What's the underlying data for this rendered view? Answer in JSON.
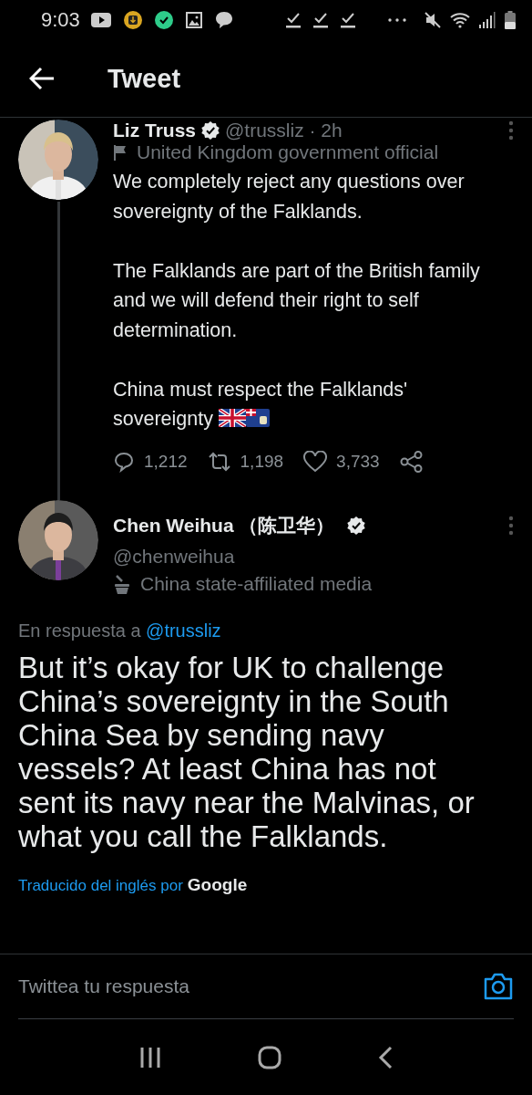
{
  "status_bar": {
    "time": "9:03"
  },
  "header": {
    "title": "Tweet"
  },
  "tweets": [
    {
      "kind": "parent",
      "thread_line": true,
      "name": "Liz Truss",
      "verified": true,
      "handle_line": "@trussliz · 2h",
      "label": {
        "kind": "flag",
        "text": "United Kingdom government official"
      },
      "text": "We completely reject any questions over sovereignty of the Falklands.\n\nThe Falklands are part of the British family and we will defend their right to self determination.\n\nChina must respect the Falklands' sovereignty",
      "stats": {
        "replies": "1,212",
        "retweets": "1,198",
        "likes": "3,733"
      }
    },
    {
      "kind": "focused",
      "thread_line": false,
      "name": "Chen Weihua （陈卫华）",
      "verified": true,
      "handle_line": "@chenweihua",
      "label": {
        "kind": "media",
        "text": "China state-affiliated media"
      },
      "reply_to": {
        "prefix": "En respuesta a",
        "mention": "@trussliz"
      },
      "text": "But it’s okay for UK to challenge China’s sovereignty in the South China Sea by sending navy vessels? At least China has not sent its navy near the Malvinas, or what you call the Falklands.",
      "translation": {
        "prefix": "Traducido del inglés por",
        "provider": "Google"
      }
    }
  ],
  "reply_box": {
    "placeholder": "Twittea tu respuesta"
  }
}
